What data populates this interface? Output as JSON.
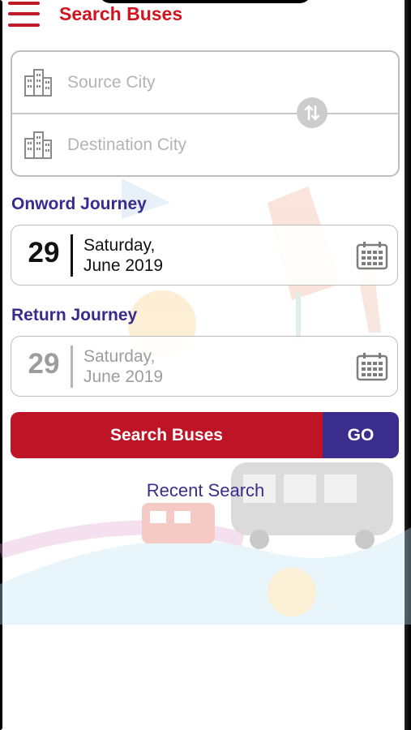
{
  "header": {
    "title": "Search Buses",
    "menu_icon": "hamburger-menu-icon",
    "accent_color": "#d1141f"
  },
  "cities": {
    "source_placeholder": "Source City",
    "source_value": "",
    "destination_placeholder": "Destination City",
    "destination_value": "",
    "city_icon": "building-icon",
    "swap_icon": "swap-arrows-icon"
  },
  "onward": {
    "label": "Onword Journey",
    "day": "29",
    "weekday": "Saturday,",
    "month_year": "June 2019",
    "calendar_icon": "calendar-icon"
  },
  "return": {
    "label": "Return Journey",
    "day": "29",
    "weekday": "Saturday,",
    "month_year": "June 2019",
    "calendar_icon": "calendar-icon"
  },
  "actions": {
    "search_label": "Search Buses",
    "go_label": "GO",
    "recent_label": "Recent Search",
    "search_color": "#be1426",
    "go_color": "#3b2d8e"
  }
}
